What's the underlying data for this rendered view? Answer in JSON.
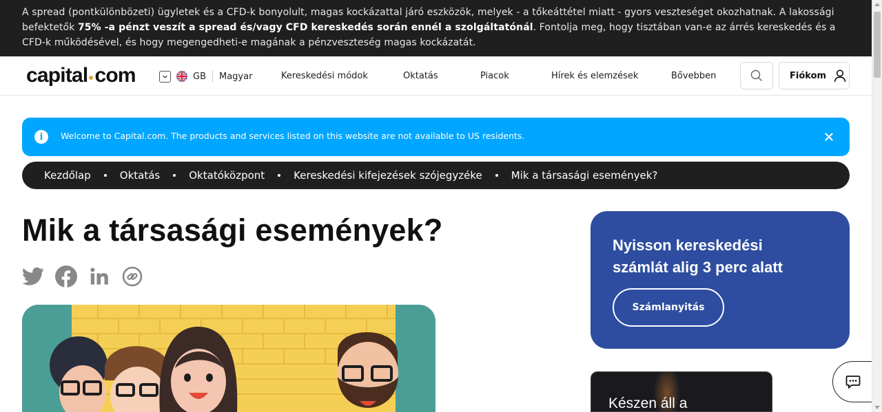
{
  "risk_banner": {
    "part1": "A spread (pontkülönbözeti) ügyletek és a CFD-k bonyolult, magas kockázattal járó eszközök, melyek - a tőkeáttétel miatt - gyors veszteséget okozhatnak. A lakossági befektetők ",
    "bold": "75% -a pénzt veszít a spread és/vagy CFD kereskedés során ennél a szolgáltatónál",
    "part2": ". Fontolja meg, hogy tisztában van-e az árrés kereskedés és a CFD-k működésével, és hogy megengedheti-e magának a pénzveszteség magas kockázatát."
  },
  "header": {
    "logo_left": "capital",
    "logo_right": "com",
    "region": "GB",
    "language": "Magyar",
    "nav": [
      "Kereskedési módok",
      "Oktatás",
      "Piacok",
      "Hírek és elemzések",
      "Bővebben"
    ],
    "account_label": "Fiókom"
  },
  "notice": {
    "text": "Welcome to Capital.com. The products and services listed on this website are not available to US residents."
  },
  "breadcrumb": [
    "Kezdőlap",
    "Oktatás",
    "Oktatóközpont",
    "Kereskedési kifejezések szójegyzéke",
    "Mik a társasági események?"
  ],
  "article": {
    "title": "Mik a társasági események?"
  },
  "social": [
    "twitter-icon",
    "facebook-icon",
    "linkedin-icon",
    "copy-link-icon"
  ],
  "cta": {
    "title": "Nyisson kereskedési számlát alig 3 perc alatt",
    "button": "Számlanyitás"
  },
  "promo": {
    "text": "Készen áll a"
  },
  "colors": {
    "notice_bg": "#00a6ff",
    "cta_bg": "#2e4da0",
    "banner_bg": "#1f1f1f",
    "logo_dot": "#e4a23e"
  }
}
